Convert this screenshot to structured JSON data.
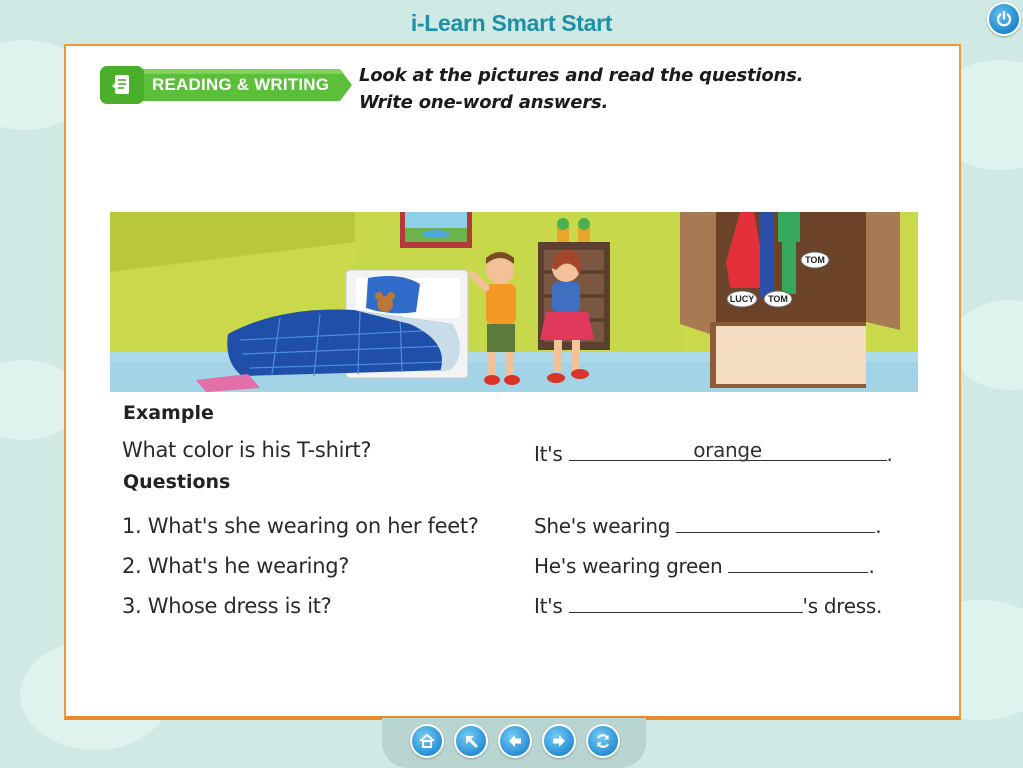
{
  "app": {
    "title": "i-Learn Smart Start"
  },
  "header": {
    "badge_label": "READING & WRITING",
    "instruction_line1": "Look at the pictures and read the questions.",
    "instruction_line2": "Write one-word answers."
  },
  "scene": {
    "name_tags": [
      "TOM",
      "LUCY",
      "TOM"
    ]
  },
  "example": {
    "heading": "Example",
    "question": "What color is his T-shirt?",
    "answer_prefix": "It's",
    "answer_value": "orange",
    "answer_suffix": "."
  },
  "questions": {
    "heading": "Questions",
    "items": [
      {
        "question": "1. What's she wearing on her feet?",
        "answer_prefix": "She's wearing",
        "answer_suffix": "."
      },
      {
        "question": "2. What's he wearing?",
        "answer_prefix": "He's wearing green",
        "answer_suffix": "."
      },
      {
        "question": "3. Whose dress is it?",
        "answer_prefix": "It's",
        "answer_suffix": "'s dress."
      }
    ]
  },
  "navigation": {
    "buttons": [
      "home-icon",
      "arrow-up-left-icon",
      "arrow-left-icon",
      "arrow-right-icon",
      "refresh-icon"
    ]
  },
  "colors": {
    "accent": "#1d8fa8",
    "page_border": "#f09a37",
    "badge": "#5cbf3a"
  }
}
